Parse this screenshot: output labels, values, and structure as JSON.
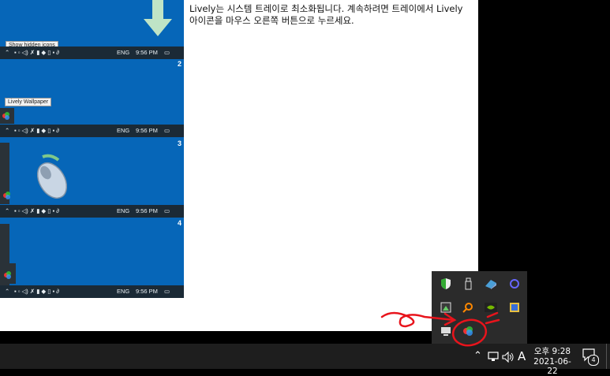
{
  "instruction": {
    "line1": "Lively는 시스템 트레이로 최소화됩니다. 계속하려면 트레이에서 Lively",
    "line2": "아이콘을 마우스 오른쪽 버튼으로 누르세요."
  },
  "panels": [
    {
      "number": "",
      "tooltip": "Show hidden icons",
      "lang": "ENG",
      "time": "9:56 PM"
    },
    {
      "number": "2",
      "tooltip": "Lively Wallpaper",
      "lang": "ENG",
      "time": "9:56 PM"
    },
    {
      "number": "3",
      "tooltip": "",
      "lang": "ENG",
      "time": "9:56 PM"
    },
    {
      "number": "4",
      "tooltip": "",
      "lang": "ENG",
      "time": "9:56 PM"
    }
  ],
  "taskbar": {
    "ime_label": "A",
    "clock_time": "오후 9:28",
    "clock_date": "2021-06-22",
    "notification_count": "4"
  },
  "icons": {
    "tray": [
      "chevron-up-icon",
      "network-icon",
      "volume-icon",
      "ime-icon",
      "notification-icon"
    ],
    "flyout": [
      "shield-icon",
      "usb-drive-icon",
      "file-sync-icon",
      "cortana-ring-icon",
      "image-icon",
      "search-tool-icon",
      "nvidia-icon",
      "app-tile-icon",
      "pc-icon",
      "lively-wallpaper-icon"
    ]
  },
  "colors": {
    "panel_blue": "#0666b8",
    "annotation_red": "#e8141c",
    "arrow_green": "#bfe4c6"
  }
}
